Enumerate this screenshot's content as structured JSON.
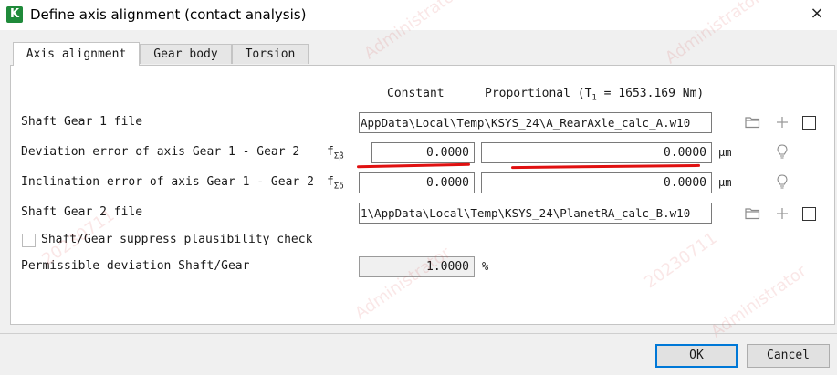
{
  "window": {
    "app_icon_letter": "K",
    "title": "Define axis alignment (contact analysis)",
    "close_symbol": "×"
  },
  "tabs": [
    {
      "label": "Axis alignment",
      "active": true
    },
    {
      "label": "Gear body",
      "active": false
    },
    {
      "label": "Torsion",
      "active": false
    }
  ],
  "columns": {
    "constant": "Constant",
    "proportional_prefix": "Proportional (T",
    "proportional_sub": "1",
    "proportional_suffix": " = 1653.169 Nm)"
  },
  "rows": {
    "shaft1": {
      "label": "Shaft Gear 1 file",
      "value": "AppData\\Local\\Temp\\KSYS_24\\A_RearAxle_calc_A.w10",
      "checked": false
    },
    "deviation": {
      "label": "Deviation error of axis Gear 1 - Gear 2",
      "symbol": "f",
      "symbol_sub": "Σβ",
      "constant": "0.0000",
      "proportional": "0.0000",
      "unit": "μm"
    },
    "inclination": {
      "label": "Inclination error of axis Gear 1 - Gear 2",
      "symbol": "f",
      "symbol_sub": "Σδ",
      "constant": "0.0000",
      "proportional": "0.0000",
      "unit": "μm"
    },
    "shaft2": {
      "label": "Shaft Gear 2 file",
      "value": "1\\AppData\\Local\\Temp\\KSYS_24\\PlanetRA_calc_B.w10",
      "checked": false
    },
    "suppress": {
      "label": "Shaft/Gear suppress plausibility check",
      "checked": false
    },
    "permissible": {
      "label": "Permissible deviation Shaft/Gear",
      "value": "1.0000",
      "unit": "%"
    }
  },
  "icons": {
    "folder": "folder-icon",
    "add": "plus-icon",
    "info": "lightbulb-icon"
  },
  "buttons": {
    "ok": "OK",
    "cancel": "Cancel"
  },
  "watermark": {
    "user": "Administrator",
    "date": "20230711"
  },
  "colors": {
    "app_icon": "#1f8a3a",
    "annotation_underline": "#e01010",
    "default_button_border": "#0078d7"
  }
}
